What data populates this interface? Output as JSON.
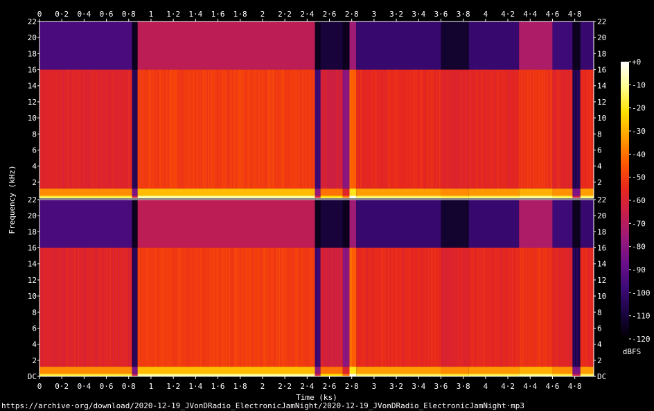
{
  "chart_data": {
    "type": "heatmap",
    "title": "",
    "xlabel": "Time (ks)",
    "ylabel": "Frequency (kHz)",
    "x_ticks": [
      "0",
      "0·2",
      "0·4",
      "0·6",
      "0·8",
      "1",
      "1·2",
      "1·4",
      "1·6",
      "1·8",
      "2",
      "2·2",
      "2·4",
      "2·6",
      "2·8",
      "3",
      "3·2",
      "3·4",
      "3·6",
      "3·8",
      "4",
      "4·2",
      "4·4",
      "4·6",
      "4·8"
    ],
    "x_tick_values": [
      0,
      0.2,
      0.4,
      0.6,
      0.8,
      1.0,
      1.2,
      1.4,
      1.6,
      1.8,
      2.0,
      2.2,
      2.4,
      2.6,
      2.8,
      3.0,
      3.2,
      3.4,
      3.6,
      3.8,
      4.0,
      4.2,
      4.4,
      4.6,
      4.8
    ],
    "xlim": [
      0,
      4.97
    ],
    "channels": [
      {
        "y_ticks": [
          "22",
          "20",
          "18",
          "16",
          "14",
          "12",
          "10",
          "8",
          "6",
          "4",
          "2"
        ]
      },
      {
        "y_ticks": [
          "22",
          "20",
          "18",
          "16",
          "14",
          "12",
          "10",
          "8",
          "6",
          "4",
          "2",
          "DC"
        ]
      }
    ],
    "y_tick_values_khz": [
      22,
      20,
      18,
      16,
      14,
      12,
      10,
      8,
      6,
      4,
      2,
      0
    ],
    "ylim_khz": [
      0,
      22
    ],
    "colorbar": {
      "label": "dBFS",
      "ticks": [
        "+0",
        "-10",
        "-20",
        "-30",
        "-40",
        "-50",
        "-60",
        "-70",
        "-80",
        "-90",
        "-100",
        "-110",
        "-120"
      ],
      "range_db": [
        -120,
        0
      ],
      "colors": [
        "#000000",
        "#1a0440",
        "#3d0a78",
        "#6a0f8a",
        "#9a1a7a",
        "#c81e4a",
        "#e8281c",
        "#ff5a00",
        "#ffa000",
        "#ffe000",
        "#ffff90",
        "#ffffff"
      ]
    },
    "time_segments_ks": [
      {
        "start": 0.0,
        "end": 0.83,
        "level_db": -58,
        "hf_cutoff_khz": 16,
        "hf_level_db": -95
      },
      {
        "start": 0.83,
        "end": 0.88,
        "level_db": -105,
        "hf_cutoff_khz": 16,
        "hf_level_db": -115
      },
      {
        "start": 0.88,
        "end": 2.47,
        "level_db": -50,
        "hf_cutoff_khz": 22,
        "hf_level_db": -68
      },
      {
        "start": 2.47,
        "end": 2.52,
        "level_db": -100,
        "hf_cutoff_khz": 16,
        "hf_level_db": -115
      },
      {
        "start": 2.52,
        "end": 2.72,
        "level_db": -62,
        "hf_cutoff_khz": 18,
        "hf_level_db": -110
      },
      {
        "start": 2.72,
        "end": 2.78,
        "level_db": -80,
        "hf_cutoff_khz": 16,
        "hf_level_db": -115
      },
      {
        "start": 2.78,
        "end": 2.84,
        "level_db": -42,
        "hf_cutoff_khz": 22,
        "hf_level_db": -75
      },
      {
        "start": 2.84,
        "end": 3.6,
        "level_db": -55,
        "hf_cutoff_khz": 16,
        "hf_level_db": -100
      },
      {
        "start": 3.6,
        "end": 3.85,
        "level_db": -58,
        "hf_cutoff_khz": 16,
        "hf_level_db": -112
      },
      {
        "start": 3.85,
        "end": 4.3,
        "level_db": -56,
        "hf_cutoff_khz": 16,
        "hf_level_db": -100
      },
      {
        "start": 4.3,
        "end": 4.6,
        "level_db": -52,
        "hf_cutoff_khz": 22,
        "hf_level_db": -72
      },
      {
        "start": 4.6,
        "end": 4.78,
        "level_db": -57,
        "hf_cutoff_khz": 16,
        "hf_level_db": -98
      },
      {
        "start": 4.78,
        "end": 4.85,
        "level_db": -105,
        "hf_cutoff_khz": 16,
        "hf_level_db": -115
      },
      {
        "start": 4.85,
        "end": 4.97,
        "level_db": -55,
        "hf_cutoff_khz": 16,
        "hf_level_db": -100
      }
    ]
  },
  "source_url": "https://archive·org/download/2020-12-19_JVonDRadio_ElectronicJamNight/2020-12-19_JVonDRadio_ElectronicJamNight·mp3"
}
